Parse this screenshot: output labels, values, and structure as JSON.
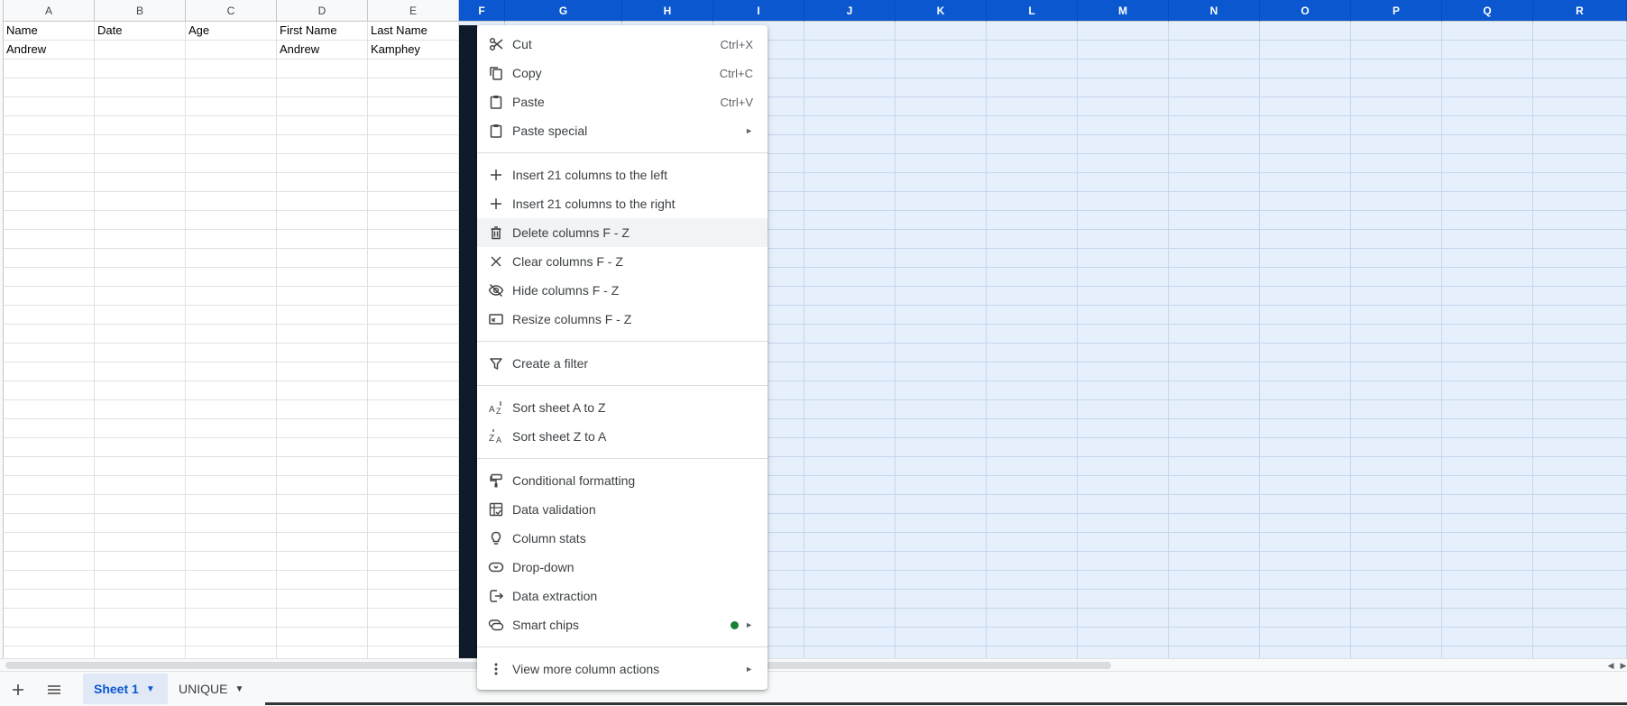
{
  "sheet": {
    "columns": [
      "A",
      "B",
      "C",
      "D",
      "E",
      "F",
      "G",
      "H",
      "I",
      "J",
      "K",
      "L",
      "M",
      "N",
      "O",
      "P",
      "Q",
      "R"
    ],
    "selected_columns": [
      "F",
      "G",
      "H",
      "I",
      "J",
      "K",
      "L",
      "M",
      "N",
      "O",
      "P",
      "Q",
      "R"
    ],
    "rows": [
      [
        "Name",
        "Date",
        "Age",
        "First Name",
        "Last Name"
      ],
      [
        "Andrew",
        "",
        "",
        "Andrew",
        "Kamphey"
      ]
    ]
  },
  "context_menu": {
    "groups": [
      [
        {
          "label": "Cut",
          "shortcut": "Ctrl+X",
          "icon": "cut-icon"
        },
        {
          "label": "Copy",
          "shortcut": "Ctrl+C",
          "icon": "copy-icon"
        },
        {
          "label": "Paste",
          "shortcut": "Ctrl+V",
          "icon": "paste-icon"
        },
        {
          "label": "Paste special",
          "submenu": true,
          "icon": "paste-special-icon"
        }
      ],
      [
        {
          "label": "Insert 21 columns to the left",
          "icon": "plus-icon"
        },
        {
          "label": "Insert 21 columns to the right",
          "icon": "plus-icon"
        },
        {
          "label": "Delete columns F - Z",
          "icon": "trash-icon",
          "hovered": true
        },
        {
          "label": "Clear columns F - Z",
          "icon": "close-icon"
        },
        {
          "label": "Hide columns F - Z",
          "icon": "eye-off-icon"
        },
        {
          "label": "Resize columns F - Z",
          "icon": "resize-icon"
        }
      ],
      [
        {
          "label": "Create a filter",
          "icon": "filter-icon"
        }
      ],
      [
        {
          "label": "Sort sheet A to Z",
          "icon": "sort-az-icon"
        },
        {
          "label": "Sort sheet Z to A",
          "icon": "sort-za-icon"
        }
      ],
      [
        {
          "label": "Conditional formatting",
          "icon": "paint-roller-icon"
        },
        {
          "label": "Data validation",
          "icon": "data-validation-icon"
        },
        {
          "label": "Column stats",
          "icon": "lightbulb-icon"
        },
        {
          "label": "Drop-down",
          "icon": "dropdown-chip-icon"
        },
        {
          "label": "Data extraction",
          "icon": "data-extraction-icon"
        },
        {
          "label": "Smart chips",
          "submenu": true,
          "badge_color": "#188038",
          "icon": "smart-chips-icon"
        }
      ],
      [
        {
          "label": "View more column actions",
          "submenu": true,
          "icon": "more-vert-icon"
        }
      ]
    ]
  },
  "bottom_bar": {
    "add_sheet_icon": "plus-icon",
    "all_sheets_icon": "menu-icon",
    "tabs": [
      {
        "label": "Sheet 1",
        "active": true
      },
      {
        "label": "UNIQUE",
        "active": false
      }
    ]
  },
  "colors": {
    "selection_header": "#0b57d0",
    "selection_fill": "#e6effc",
    "menu_hover": "#f1f3f4",
    "active_tab_bg": "#e1e9f7"
  }
}
